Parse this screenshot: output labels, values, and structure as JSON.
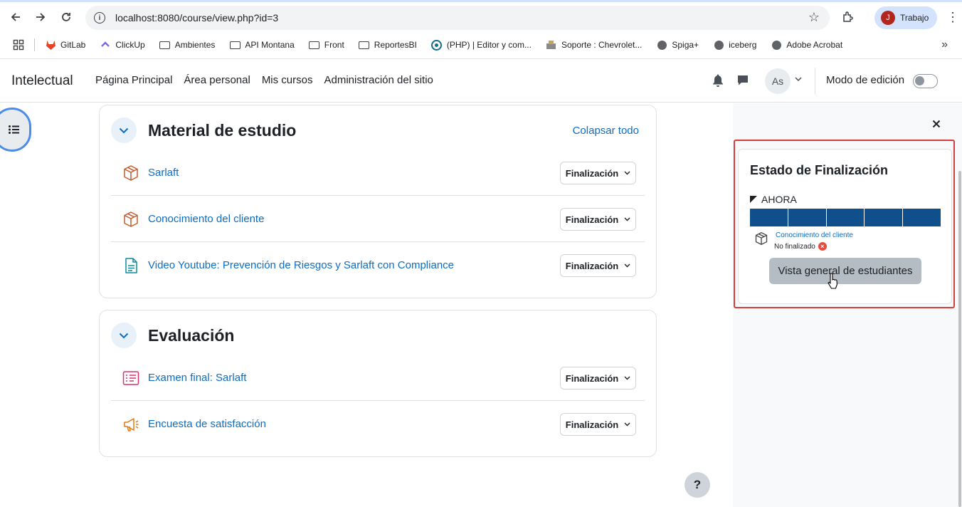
{
  "browser": {
    "url": "localhost:8080/course/view.php?id=3",
    "profile_initial": "J",
    "profile_name": "Trabajo",
    "bookmarks": [
      {
        "label": "GitLab",
        "icon": "gitlab-icon"
      },
      {
        "label": "ClickUp",
        "icon": "clickup-icon"
      },
      {
        "label": "Ambientes",
        "icon": "folder-icon"
      },
      {
        "label": "API Montana",
        "icon": "folder-icon"
      },
      {
        "label": "Front",
        "icon": "folder-icon"
      },
      {
        "label": "ReportesBI",
        "icon": "folder-icon"
      },
      {
        "label": "(PHP) | Editor y com...",
        "icon": "php-icon"
      },
      {
        "label": "Soporte : Chevrolet...",
        "icon": "support-icon"
      },
      {
        "label": "Spiga+",
        "icon": "globe-icon"
      },
      {
        "label": "iceberg",
        "icon": "globe-icon"
      },
      {
        "label": "Adobe Acrobat",
        "icon": "globe-icon"
      }
    ]
  },
  "navbar": {
    "brand": "Intelectual",
    "links": [
      "Página Principal",
      "Área personal",
      "Mis cursos",
      "Administración del sitio"
    ],
    "user_initials": "As",
    "edit_mode_label": "Modo de edición",
    "edit_mode_on": false
  },
  "sections": [
    {
      "title": "Material de estudio",
      "collapse_all": "Colapsar todo",
      "activities": [
        {
          "name": "Sarlaft",
          "icon": "package-icon",
          "button": "Finalización"
        },
        {
          "name": "Conocimiento del cliente",
          "icon": "package-icon",
          "button": "Finalización"
        },
        {
          "name": "Video Youtube: Prevención de Riesgos y Sarlaft con Compliance",
          "icon": "page-icon",
          "button": "Finalización"
        }
      ]
    },
    {
      "title": "Evaluación",
      "activities": [
        {
          "name": "Examen final: Sarlaft",
          "icon": "quiz-icon",
          "button": "Finalización"
        },
        {
          "name": "Encuesta de satisfacción",
          "icon": "feedback-icon",
          "button": "Finalización"
        }
      ]
    }
  ],
  "block": {
    "title": "Estado de Finalización",
    "now_label": "AHORA",
    "segments": 5,
    "item_name": "Conocimiento del cliente",
    "item_status": "No finalizado",
    "overview_button": "Vista general de estudiantes"
  },
  "colors": {
    "link": "#0f6cbf",
    "progress": "#0f4f8c",
    "highlight": "#d93c3c",
    "package_icon": "#c25c2e",
    "page_icon": "#0d8a9e",
    "quiz_icon": "#d6336c",
    "feedback_icon": "#e57a10"
  },
  "help_label": "?"
}
